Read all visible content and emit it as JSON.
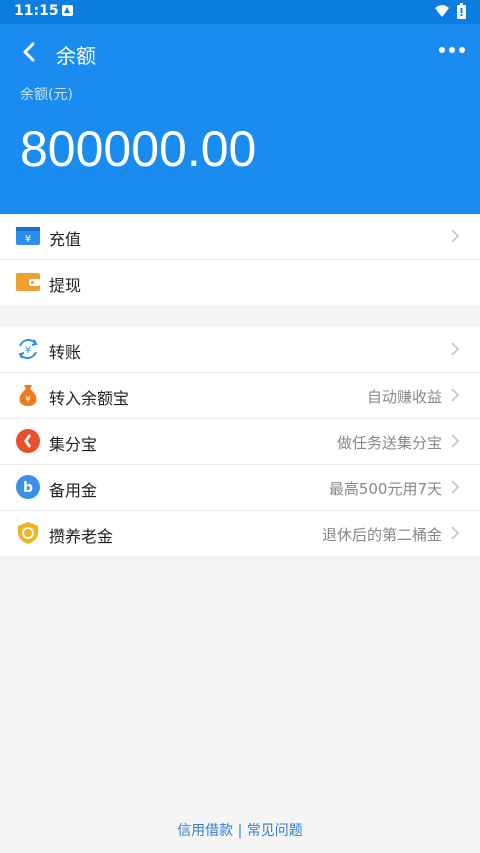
{
  "status_bar": {
    "time": "11:15"
  },
  "header": {
    "title": "余额",
    "balance_label": "余额(元)",
    "balance_amount": "800000.00"
  },
  "colors": {
    "header_bg": "#1a8cf0",
    "status_bg": "#0d7de0",
    "link": "#2f7fd6"
  },
  "section1": {
    "items": [
      {
        "label": "充值",
        "hint": "",
        "icon": "recharge-icon",
        "chevron": true
      },
      {
        "label": "提现",
        "hint": "",
        "icon": "wallet-icon",
        "chevron": false
      }
    ]
  },
  "section2": {
    "items": [
      {
        "label": "转账",
        "hint": "",
        "icon": "transfer-icon",
        "chevron": true
      },
      {
        "label": "转入余额宝",
        "hint": "自动赚收益",
        "icon": "money-bag-icon",
        "chevron": true
      },
      {
        "label": "集分宝",
        "hint": "做任务送集分宝",
        "icon": "points-icon",
        "chevron": true
      },
      {
        "label": "备用金",
        "hint": "最高500元用7天",
        "icon": "reserve-fund-icon",
        "chevron": true
      },
      {
        "label": "攒养老金",
        "hint": "退休后的第二桶金",
        "icon": "pension-shield-icon",
        "chevron": true
      }
    ]
  },
  "footer": {
    "links": "信用借款 | 常见问题"
  }
}
